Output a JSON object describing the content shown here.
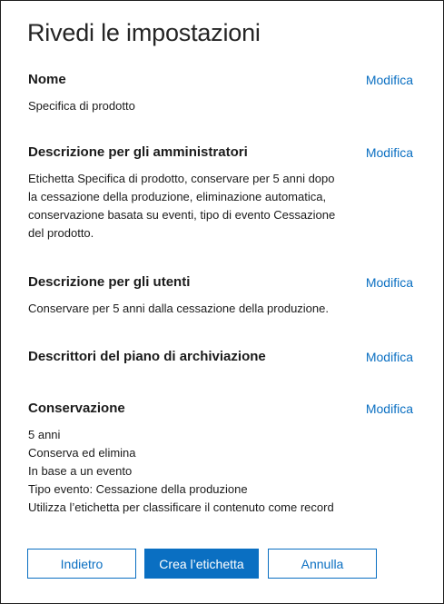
{
  "panel": {
    "title": "Rivedi le impostazioni"
  },
  "edit_label": "Modifica",
  "sections": [
    {
      "title": "Nome",
      "lines": [
        "Specifica di prodotto"
      ]
    },
    {
      "title": "Descrizione per gli amministratori",
      "lines": [
        "Etichetta Specifica di prodotto, conservare per 5 anni dopo",
        "la cessazione della produzione, eliminazione automatica,",
        "conservazione basata su eventi, tipo di evento Cessazione",
        "del prodotto."
      ]
    },
    {
      "title": "Descrizione per gli utenti",
      "lines": [
        "Conservare per 5 anni dalla cessazione della produzione."
      ]
    },
    {
      "title": "Descrittori del piano di archiviazione",
      "lines": []
    },
    {
      "title": "Conservazione",
      "lines": [
        "5 anni",
        "Conserva ed elimina",
        "In base a un evento",
        "Tipo evento: Cessazione della produzione",
        "Utilizza l’etichetta per classificare il contenuto come record"
      ]
    }
  ],
  "buttons": {
    "back": "Indietro",
    "create": "Crea l’etichetta",
    "cancel": "Annulla"
  },
  "colors": {
    "accent": "#0a6fc2",
    "text": "#1b1b1b",
    "border": "#1f1f1f"
  }
}
